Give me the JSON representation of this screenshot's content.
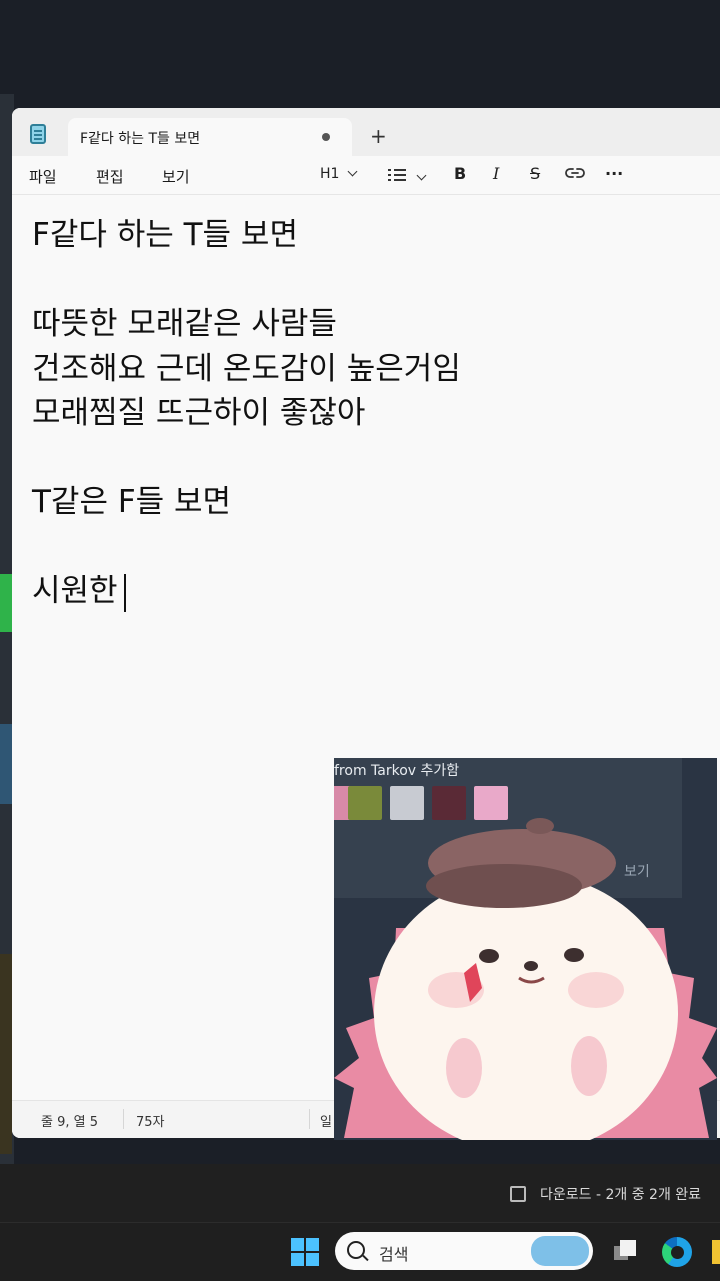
{
  "window": {
    "tab_title": "F같다 하는 T들 보면",
    "new_tab": "+"
  },
  "menu": {
    "file": "파일",
    "edit": "편집",
    "view": "보기"
  },
  "toolbar": {
    "heading": "H1",
    "bold": "B",
    "italic": "I",
    "strike": "S",
    "more": "···"
  },
  "document": {
    "lines": [
      "F같다 하는 T들 보면",
      "",
      "따뜻한 모래같은 사람들",
      "건조해요 근데 온도감이 높은거임",
      "모래찜질 뜨근하이 좋잖아",
      "",
      "T같은 F들 보면",
      "",
      "시원한"
    ]
  },
  "status": {
    "position": "줄 9, 열 5",
    "count": "75자",
    "partial": "일"
  },
  "overlay": {
    "title": "from Tarkov 추가함",
    "link": "보기",
    "colors": {
      "hat": "#8a6464",
      "body": "#fdf5ee",
      "spikes": "#e98ba4"
    }
  },
  "taskbar": {
    "download_text": "다운로드 - 2개 중 2개 완료",
    "search_placeholder": "검색"
  }
}
